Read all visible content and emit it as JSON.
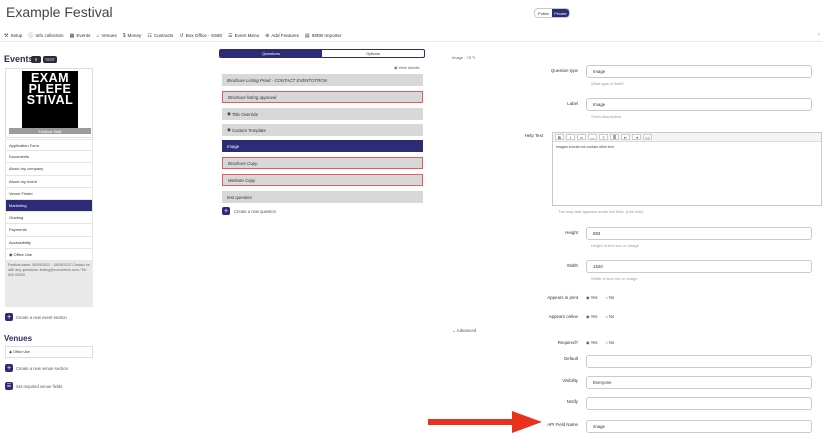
{
  "app": {
    "title": "Example Festival"
  },
  "visibility_toggle": {
    "options": [
      "Public",
      "Private"
    ],
    "selected": "Private"
  },
  "navbar": {
    "items": [
      {
        "icon": "wrench-icon",
        "label": "Setup"
      },
      {
        "icon": "info-icon",
        "label": "Info collection"
      },
      {
        "icon": "calendar-icon",
        "label": "Events"
      },
      {
        "icon": "home-icon",
        "label": "Venues"
      },
      {
        "icon": "dollar-icon",
        "label": "Money"
      },
      {
        "icon": "document-icon",
        "label": "Contracts"
      },
      {
        "icon": "ticket-icon",
        "label": "Box Office - SS80"
      },
      {
        "icon": "menu-icon",
        "label": "Event Menu"
      },
      {
        "icon": "plus-circle-icon",
        "label": "Add Features"
      },
      {
        "icon": "table-icon",
        "label": "IMDB Importer"
      }
    ],
    "collapse_glyph": "‹"
  },
  "left": {
    "events_heading": "Events",
    "test_button": "TEST",
    "logo_lines": [
      "EXAM",
      "PLEFE",
      "STIVAL"
    ],
    "logo_caption": "Festival Staff",
    "side_items": [
      "Application Form",
      "Documents",
      "About my company",
      "About my event",
      "Venue Finder",
      "Marketing",
      "Grading",
      "Payments",
      "Accessibility",
      "Office Use"
    ],
    "active_item": "Marketing",
    "festival_info": "Festival dates: 06/05/2022 - 18/05/2022  Contact us with any questions: testing@eventotron.com / Tel: 000 00000",
    "create_event_section": "Create a new event section",
    "venues_heading": "Venues",
    "venue_item": "Office Use",
    "create_venue_section": "Create a new venue section",
    "set_required_venue_fields": "Set required venue fields"
  },
  "middle": {
    "tabs": [
      "Questions",
      "Options"
    ],
    "active_tab": "Questions",
    "hide_details": "Hide details",
    "questions": [
      {
        "label": "Brochure Listing Proof - CONTACT EVENTOTRON",
        "italic": true,
        "red": false,
        "active": false
      },
      {
        "label": "Brochure listing approval",
        "italic": true,
        "red": true,
        "active": false
      },
      {
        "label": "Title Override",
        "italic": false,
        "red": false,
        "active": false,
        "icon": "eye-icon"
      },
      {
        "label": "Custom Template",
        "italic": false,
        "red": false,
        "active": false,
        "icon": "eye-icon"
      },
      {
        "label": "Image",
        "italic": false,
        "red": false,
        "active": true
      },
      {
        "label": "Brochure Copy",
        "italic": true,
        "red": true,
        "active": false
      },
      {
        "label": "Website Copy",
        "italic": true,
        "red": true,
        "active": false
      },
      {
        "label": "test question",
        "italic": false,
        "red": false,
        "active": false
      }
    ],
    "create_question": "Create a new question",
    "question_counter": "Image - 70 ✎",
    "advanced": "Advanced"
  },
  "form": {
    "question_type": {
      "label": "Question type",
      "value": "Image",
      "help": "What type of field?"
    },
    "label": {
      "label": "Label",
      "value": "Image",
      "help": "Short description"
    },
    "help_text": {
      "label": "Help Text",
      "value": "Images should not contain other text",
      "help": "The help that appears under the field. (Like this)"
    },
    "height": {
      "label": "Height",
      "value": "883",
      "help": "Height of text box or image"
    },
    "width": {
      "label": "Width",
      "value": "1520",
      "help": "Width of text box or image"
    },
    "appears_in_print": {
      "label": "Appears in print",
      "options": [
        "Yes",
        "No"
      ],
      "selected": "Yes"
    },
    "appears_online": {
      "label": "Appears online",
      "options": [
        "Yes",
        "No"
      ],
      "selected": "Yes"
    },
    "required": {
      "label": "Required?",
      "options": [
        "Yes",
        "No"
      ],
      "selected": "Yes"
    },
    "default": {
      "label": "Default",
      "value": ""
    },
    "visibility": {
      "label": "Visibility",
      "value": "Everyone"
    },
    "notify": {
      "label": "Notify",
      "value": ""
    },
    "api_field_name": {
      "label": "API Field Name",
      "value": "image"
    }
  },
  "colors": {
    "accent": "#2b2b78",
    "annotation_arrow": "#e8321e",
    "required_border": "#e55a5a"
  }
}
